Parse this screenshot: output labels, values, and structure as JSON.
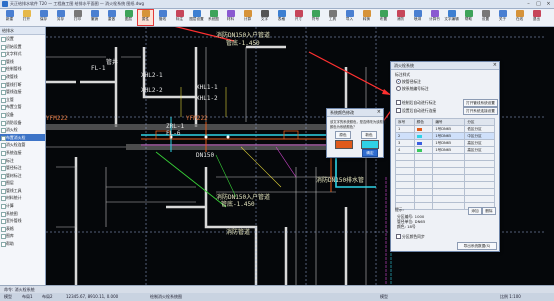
{
  "window": {
    "title": "天正给排水软件 T20 — 工程施工图 给排水平面图 — 消火栓系统 图纸.dwg"
  },
  "toolbar": {
    "items": [
      {
        "label": "新建",
        "color": "#4a7fd1"
      },
      {
        "label": "打开",
        "color": "#e6b84a"
      },
      {
        "label": "保存",
        "color": "#4a7fd1"
      },
      {
        "label": "另存",
        "color": "#4a7fd1"
      },
      {
        "label": "打印",
        "color": "#777777"
      },
      {
        "label": "撤销",
        "color": "#4a7fd1"
      },
      {
        "label": "重做",
        "color": "#4a7fd1"
      },
      {
        "label": "图层",
        "color": "#3da35a"
      },
      {
        "label": "属性",
        "color": "#d6933a"
      },
      {
        "label": "管线",
        "color": "#4a7fd1"
      },
      {
        "label": "标注",
        "color": "#c6465a"
      },
      {
        "label": "图层设置",
        "color": "#3d7fd1"
      },
      {
        "label": "系统图",
        "color": "#3da35a"
      },
      {
        "label": "材料",
        "color": "#8a5ad1"
      },
      {
        "label": "计算",
        "color": "#d6933a"
      },
      {
        "label": "文字",
        "color": "#555555"
      },
      {
        "label": "表格",
        "color": "#3d7fd1"
      },
      {
        "label": "尺寸",
        "color": "#c6465a"
      },
      {
        "label": "符号",
        "color": "#3da35a"
      },
      {
        "label": "工具",
        "color": "#777777"
      },
      {
        "label": "导入",
        "color": "#4a7fd1"
      },
      {
        "label": "转换",
        "color": "#d6933a"
      },
      {
        "label": "布置",
        "color": "#3da35a"
      },
      {
        "label": "消防",
        "color": "#c6465a"
      },
      {
        "label": "喷淋",
        "color": "#4a7fd1"
      },
      {
        "label": "计算书",
        "color": "#8a5ad1"
      },
      {
        "label": "文字编辑",
        "color": "#3d7fd1"
      },
      {
        "label": "帮助",
        "color": "#3da35a"
      },
      {
        "label": "设置",
        "color": "#777777"
      },
      {
        "label": "关于",
        "color": "#4a7fd1"
      },
      {
        "label": "在线",
        "color": "#d6933a"
      },
      {
        "label": "退出",
        "color": "#c6465a"
      }
    ]
  },
  "leftpanel": {
    "header": "给排水",
    "items": [
      "设置",
      "初始设置",
      "文字样式",
      "管线",
      "绘制管线",
      "改管线",
      "管线打断",
      "管线连接",
      "立管",
      "布置立管",
      "设备",
      "消防设备",
      "消火栓",
      "布置消火栓",
      "消火栓连管",
      "系统连接",
      "标注",
      "管径标注",
      "管材标注",
      "图层",
      "管线工具",
      "材料统计",
      "计算",
      "系统图",
      "室外管线",
      "表格",
      "图库",
      "帮助"
    ],
    "selected_index": 13
  },
  "drawing": {
    "labels": [
      {
        "text": "消防DN150入户管道",
        "cls": "y"
      },
      {
        "text": "管底-1.450",
        "cls": "y"
      },
      {
        "text": "管井",
        "cls": ""
      },
      {
        "text": "FL-1",
        "cls": ""
      },
      {
        "text": "XHL2-1",
        "cls": ""
      },
      {
        "text": "XHL2-2",
        "cls": ""
      },
      {
        "text": "XHL1-1",
        "cls": ""
      },
      {
        "text": "XHL1-2",
        "cls": ""
      },
      {
        "text": "YFM222",
        "cls": "o"
      },
      {
        "text": "YFM222",
        "cls": "o"
      },
      {
        "text": "ZRL-1",
        "cls": ""
      },
      {
        "text": "FL-6",
        "cls": ""
      },
      {
        "text": "消防DN150入户管道",
        "cls": "y"
      },
      {
        "text": "管底-1.450",
        "cls": "y"
      },
      {
        "text": "消防DN150排水管",
        "cls": "y"
      },
      {
        "text": "DN150",
        "cls": ""
      },
      {
        "text": "消防管道",
        "cls": "y"
      }
    ]
  },
  "dialog_main": {
    "title": "消火栓系统",
    "section1": "标注样式",
    "radio1": "按管径标注",
    "radio2": "按系统编号标注",
    "check1": "绘制后自动进行标注",
    "btn1": "打开管线系统设置",
    "check2": "设置后自动进行连接",
    "btn2": "打开系统连接设置",
    "table_headers": [
      "序号",
      "颜色",
      "编号",
      "分区"
    ],
    "rows": [
      {
        "no": "1",
        "color": "#e05a1a",
        "code": "1号DN65",
        "zone": "低区分区"
      },
      {
        "no": "2",
        "color": "#2fd3e6",
        "code": "1号DN65",
        "zone": "中区分区"
      },
      {
        "no": "3",
        "color": "#3a5ee0",
        "code": "1号DN65",
        "zone": "高区分区"
      },
      {
        "no": "4",
        "color": "#3ac95e",
        "code": "1号DN65",
        "zone": "高区分区"
      }
    ],
    "selected_row": 1,
    "info_label": "提示:",
    "info_lines": [
      "分区编号: 1000",
      "管径单位: DN65",
      "颜色: 18号"
    ],
    "add_btn": "添加",
    "del_btn": "删除",
    "check3": "分区颜色同步",
    "bottom_btn": "导出系统数据(S)"
  },
  "dialog_color": {
    "title": "系统颜色修改",
    "msg1": "该文字的系统颜色，是否修改为该颜色",
    "msg2": "颜色为系统颜色？",
    "col_label_left": "原色",
    "col_label_right": "新色",
    "old_color": "#e05a1a",
    "new_color": "#2fd3e6",
    "ok": "确定",
    "cancel": "取消"
  },
  "cmdline": {
    "text": "命令: 消火栓系统"
  },
  "statusbar": {
    "coords": "12345.67, 8910.11, 0.000",
    "mode": "模型",
    "scale": "比例 1:100",
    "hint": "绘制消火栓系统图",
    "tabs": [
      "模型",
      "布局1",
      "布局2"
    ]
  }
}
